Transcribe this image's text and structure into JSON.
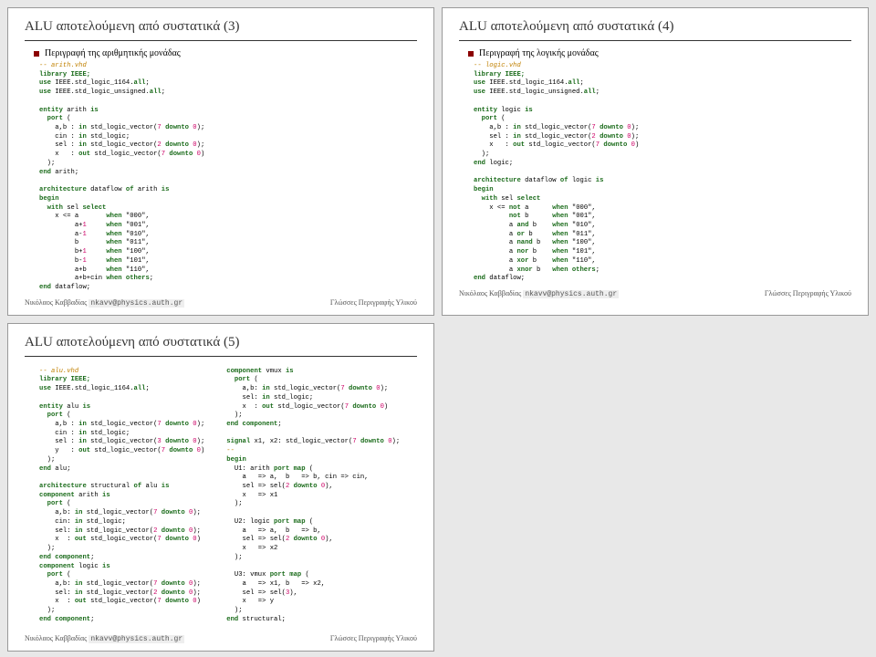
{
  "slides": {
    "s1": {
      "title": "ALU αποτελούμενη από συστατικά (3)",
      "bullet": "Περιγραφή της αριθμητικής μονάδας"
    },
    "s2": {
      "title": "ALU αποτελούμενη από συστατικά (4)",
      "bullet": "Περιγραφή της λογικής μονάδας"
    },
    "s3": {
      "title": "ALU αποτελούμενη από συστατικά (5)"
    }
  },
  "footer": {
    "author": "Νικόλαος Καββαδίας",
    "email": "nkavv@physics.auth.gr",
    "course": "Γλώσσες Περιγραφής Υλικού"
  },
  "code": {
    "arith_comment": "-- arith.vhd",
    "lib_ieee": "library IEEE;",
    "use1": "use IEEE.std_logic_1164.all;",
    "use2": "use IEEE.std_logic_unsigned.all;",
    "entity_arith_is": "entity arith is",
    "port_open": "  port (",
    "ab_in": "    a,b : in std_logic_vector(7 downto 0);",
    "cin_in": "    cin : in std_logic;",
    "sel_in2": "    sel : in std_logic_vector(2 downto 0);",
    "x_out": "    x   : out std_logic_vector(7 downto 0)",
    "port_close": "  );",
    "end_arith": "end arith;",
    "arch_arith": "architecture dataflow of arith is",
    "begin": "begin",
    "with_sel": "  with sel select",
    "xa000": "    x <= a     when \"000\",",
    "a1001": "         a+1   when \"001\",",
    "am1010": "         a-1   when \"010\",",
    "b011": "         b     when \"011\",",
    "bp1100": "         b+1   when \"100\",",
    "bm1101": "         b-1   when \"101\",",
    "apb110": "         a+b   when \"110\",",
    "apbcin": "         a+b+cin when others;",
    "end_dataflow": "end dataflow;",
    "logic_comment": "-- logic.vhd",
    "entity_logic_is": "entity logic is",
    "abl_in": "    a,b : in std_logic_vector(7 downto 0);",
    "sell_in": "    sel : in std_logic_vector(2 downto 0);",
    "xl_out": "    x   : out std_logic_vector(7 downto 0)",
    "end_logic": "end logic;",
    "arch_logic": "architecture dataflow of logic is",
    "notA": "    x <= not a      when \"000\",",
    "notB": "         not b      when \"001\",",
    "aandb": "         a and b    when \"010\",",
    "aorb": "         a or b     when \"011\",",
    "anandb": "         a nand b   when \"100\",",
    "anorb": "         a nor b    when \"101\",",
    "axorb": "         a xor b    when \"110\",",
    "axnorb": "         a xnor b   when others;",
    "alu_comment": "-- alu.vhd",
    "entity_alu_is": "entity alu is",
    "sel3": "    sel : in std_logic_vector(3 downto 0);",
    "y_out": "    y   : out std_logic_vector(7 downto 0)",
    "end_alu": "end alu;",
    "arch_struct": "architecture structural of alu is",
    "comp_arith": "component arith is",
    "abc": "    a,b: in std_logic_vector(7 downto 0);",
    "cinc": "    cin: in std_logic;",
    "selc2": "    sel: in std_logic_vector(2 downto 0);",
    "xc": "    x  : out std_logic_vector(7 downto 0)",
    "end_comp": "end component;",
    "comp_logic": "component logic is",
    "comp_vmux": "component vmux is",
    "selvc": "    sel: in std_logic;",
    "sig_x1x2": "signal x1, x2: std_logic_vector(7 downto 0);",
    "dashdash": "--",
    "u1": "  U1: arith port map (",
    "u1a": "    a   => a,  b   => b, cin => cin,",
    "u1sel": "    sel => sel(2 downto 0),",
    "u1x": "    x   => x1",
    "close_paren": "  );",
    "u2": "  U2: logic port map (",
    "u2a": "    a   => a,  b   => b,",
    "u2sel": "    sel => sel(2 downto 0),",
    "u2x": "    x   => x2",
    "u3": "  U3: vmux port map (",
    "u3a": "    a   => x1, b   => x2,",
    "u3sel": "    sel => sel(3),",
    "u3x": "    x   => y",
    "end_struct": "end structural;"
  }
}
